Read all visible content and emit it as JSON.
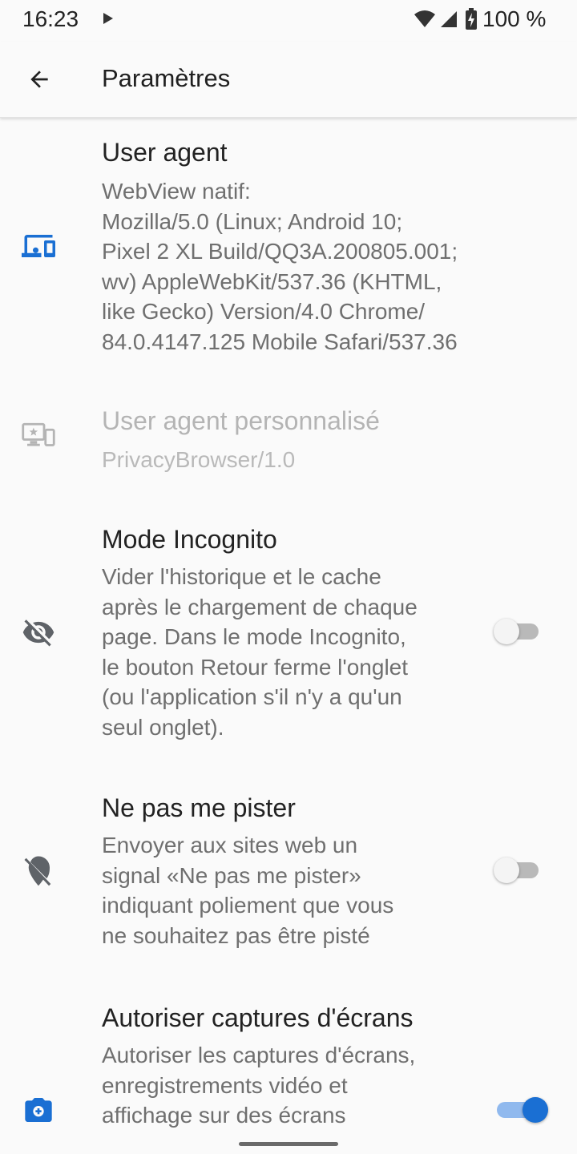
{
  "status_bar": {
    "time": "16:23",
    "battery_text": "100 %"
  },
  "app_bar": {
    "title": "Paramètres"
  },
  "preferences": [
    {
      "icon": "devices-icon",
      "title": "User agent",
      "summary": "WebView natif:\nMozilla/5.0 (Linux; Android 10;\nPixel 2 XL Build/QQ3A.200805.001;\nwv) AppleWebKit/537.36 (KHTML,\nlike Gecko) Version/4.0 Chrome/\n84.0.4147.125 Mobile Safari/537.36",
      "enabled": true
    },
    {
      "icon": "custom-user-agent-icon",
      "title": "User agent personnalisé",
      "summary": "PrivacyBrowser/1.0",
      "enabled": false
    },
    {
      "icon": "visibility-off-icon",
      "title": "Mode Incognito",
      "summary": "Vider l'historique et le cache\naprès le chargement de chaque\npage. Dans le mode Incognito,\nle bouton Retour ferme l'onglet\n(ou l'application s'il n'y a qu'un\nseul onglet).",
      "switch_on": false
    },
    {
      "icon": "location-off-icon",
      "title": "Ne pas me pister",
      "summary": "Envoyer aux sites web un\nsignal «Ne pas me pister»\nindiquant poliement que vous\nne souhaitez pas être pisté",
      "switch_on": false
    },
    {
      "icon": "camera-icon",
      "title": "Autoriser captures d'écrans",
      "summary": "Autoriser les captures d'écrans,\nenregistrements vidéo et\naffichage sur des écrans",
      "switch_on": true
    }
  ],
  "colors": {
    "accent": "#1a6fd3",
    "icon_grey": "#5f6368",
    "disabled_grey": "#b4b4b4",
    "background": "#fafafa"
  }
}
